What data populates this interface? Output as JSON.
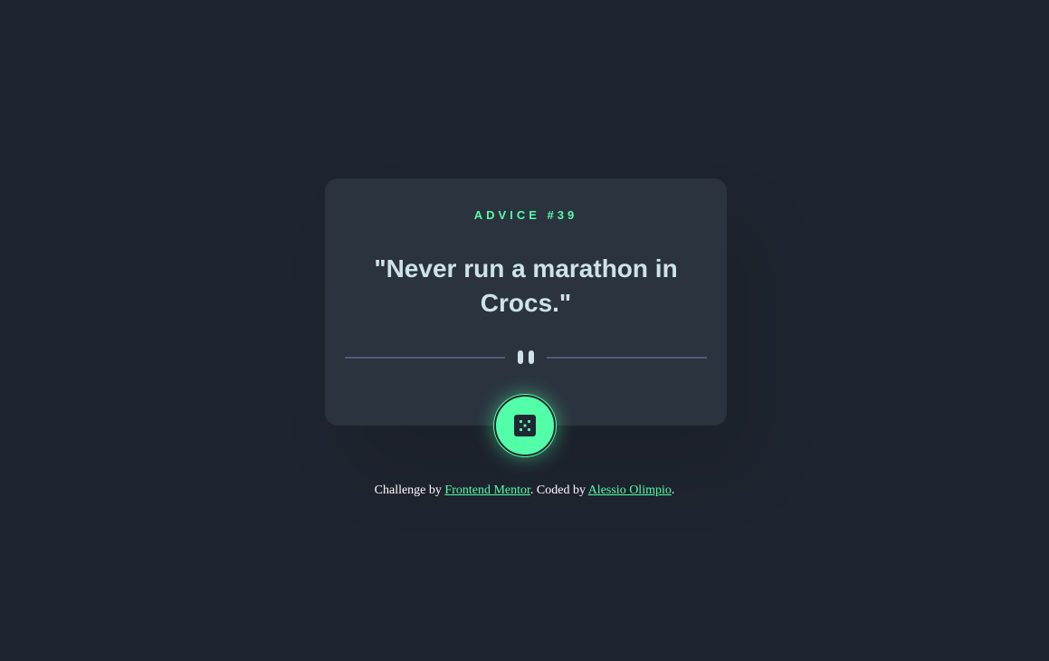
{
  "card": {
    "advice_label": "ADVICE #39",
    "quote": "\"Never run a marathon in Crocs.\""
  },
  "button": {
    "icon": "dice-icon",
    "accent": "#52ffa8"
  },
  "footer": {
    "prefix": "Challenge by ",
    "link1": "Frontend Mentor",
    "middle": ". Coded by ",
    "link2": "Alessio Olimpio",
    "suffix": "."
  },
  "colors": {
    "background": "#1f2530",
    "card": "#2b333f",
    "accent": "#52ffa8",
    "text": "#cee3e9",
    "divider": "#4f5d74"
  }
}
